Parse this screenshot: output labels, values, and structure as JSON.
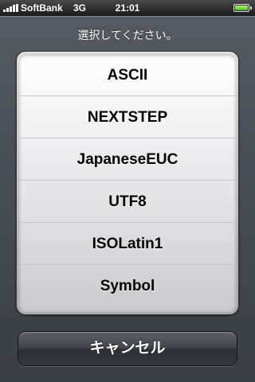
{
  "status_bar": {
    "carrier": "SoftBank",
    "network": "3G",
    "time": "21:01",
    "signal_bars": 5,
    "battery_level": 1.0
  },
  "sheet": {
    "title": "選択してください。",
    "options": [
      {
        "label": "ASCII"
      },
      {
        "label": "NEXTSTEP"
      },
      {
        "label": "JapaneseEUC"
      },
      {
        "label": "UTF8"
      },
      {
        "label": "ISOLatin1"
      },
      {
        "label": "Symbol"
      }
    ],
    "cancel_label": "キャンセル"
  },
  "colors": {
    "sheet_background": "#4f545a",
    "picker_background": "#f1f1f3",
    "cancel_button": "#3e4349",
    "battery_fill": "#4fb81e"
  },
  "icons": [
    "signal-strength-icon",
    "battery-icon"
  ]
}
